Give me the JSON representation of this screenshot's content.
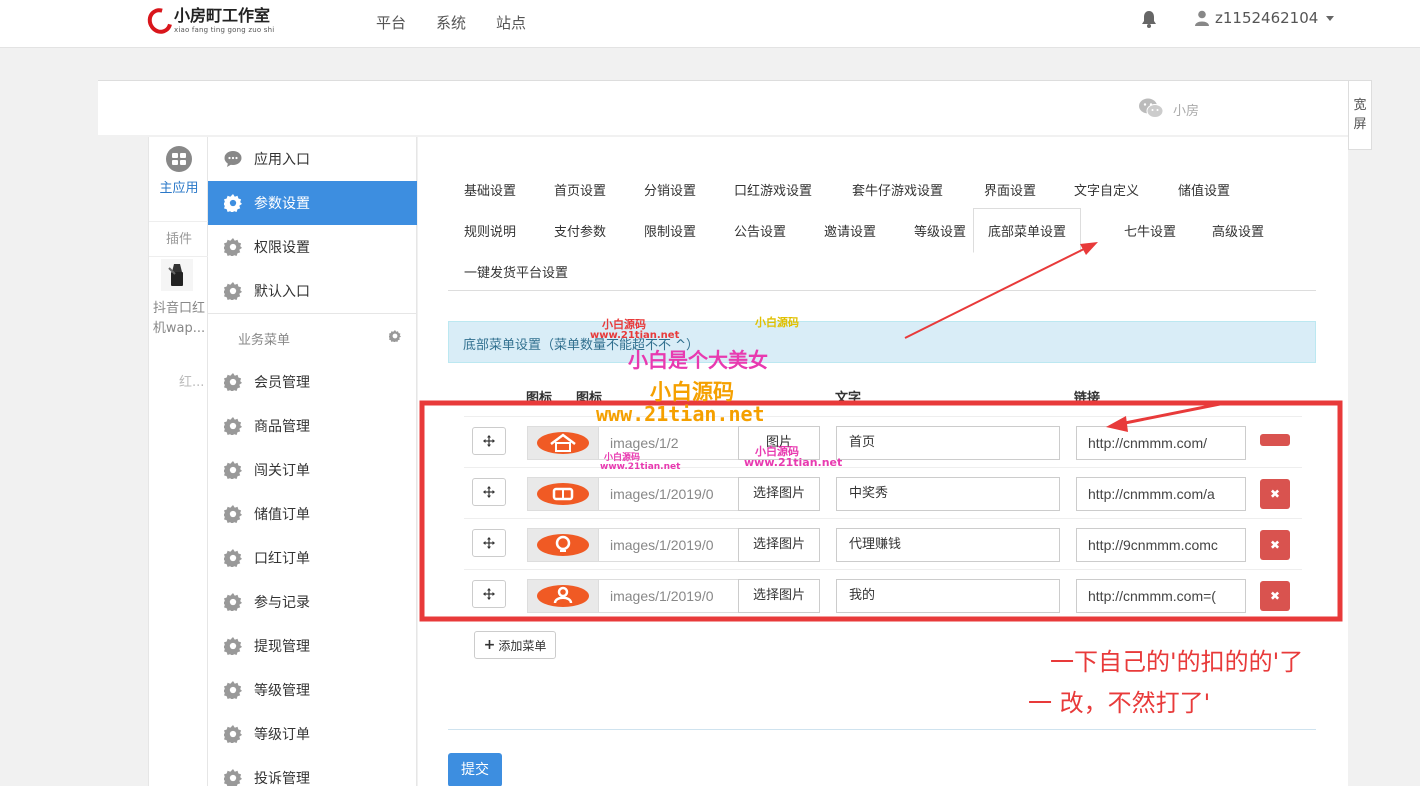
{
  "header": {
    "logo_cn": "小房町工作室",
    "logo_pinyin": "xiao fang ting gong zuo shi",
    "nav": [
      "平台",
      "系统",
      "站点"
    ],
    "username": "z1152462104"
  },
  "subbar": {
    "text": "小房",
    "fullscreen_label": "宽屏"
  },
  "leftcol": {
    "main_app_label": "主应用",
    "plugin_label": "插件",
    "plugin_name": "抖音口红机wap...",
    "plugin_name_faded": "红..."
  },
  "sidebar": {
    "top_items": [
      {
        "label": "应用入口",
        "icon": "chat-icon"
      },
      {
        "label": "参数设置",
        "icon": "gear-icon"
      },
      {
        "label": "权限设置",
        "icon": "gear-icon"
      },
      {
        "label": "默认入口",
        "icon": "gear-icon"
      }
    ],
    "section_title": "业务菜单",
    "biz_items": [
      "会员管理",
      "商品管理",
      "闯关订单",
      "储值订单",
      "口红订单",
      "参与记录",
      "提现管理",
      "等级管理",
      "等级订单",
      "投诉管理"
    ]
  },
  "tabs": {
    "row1": [
      "基础设置",
      "首页设置",
      "分销设置",
      "口红游戏设置",
      "套牛仔游戏设置",
      "界面设置",
      "文字自定义",
      "储值设置"
    ],
    "row2": [
      "规则说明",
      "支付参数",
      "限制设置",
      "公告设置",
      "邀请设置",
      "等级设置",
      "底部菜单设置",
      "七牛设置",
      "高级设置"
    ],
    "row3": [
      "一键发货平台设置"
    ],
    "active": "底部菜单设置"
  },
  "alert": {
    "text": "底部菜单设置（菜单数量不能超不不 ^）"
  },
  "table": {
    "headers": {
      "icon1": "图标",
      "icon2": "图标",
      "text": "文字",
      "link": "链接"
    },
    "rows": [
      {
        "image_path": "images/1/2",
        "image_btn": "图片",
        "text": "首页",
        "link": "http://cnmmm.com/",
        "icon": "home-icon"
      },
      {
        "image_path": "images/1/2019/0",
        "image_btn": "选择图片",
        "text": "中奖秀",
        "link": "http://cnmmm.com/a",
        "icon": "ticket-icon"
      },
      {
        "image_path": "images/1/2019/0",
        "image_btn": "选择图片",
        "text": "代理赚钱",
        "link": "http://9cnmmm.comc",
        "icon": "bulb-icon"
      },
      {
        "image_path": "images/1/2019/0",
        "image_btn": "选择图片",
        "text": "我的",
        "link": "http://cnmmm.com=(",
        "icon": "user-icon"
      }
    ],
    "add_label": "添加菜单"
  },
  "submit_label": "提交",
  "watermarks": {
    "wm1": "小白源码",
    "wm1_url": "www.21tian.net",
    "wm2": "小白源码",
    "wm_big1": "小白是个大美女",
    "wm_big2": "小白源码",
    "wm_big_url": "www.21tian.net",
    "wm3": "小白源码",
    "wm3_url": "www.21tian.net",
    "wm4": "小白源码",
    "wm4_url": "www.21tian.net"
  },
  "notes": {
    "line1": "一下自己的'的扣的的'了",
    "line2": "一 改，不然打了'"
  },
  "colors": {
    "primary": "#3d8ee0",
    "danger": "#d9534f",
    "annotation": "#e83a3a",
    "alert_bg": "#d9edf7",
    "icon_orange": "#f05a24"
  }
}
